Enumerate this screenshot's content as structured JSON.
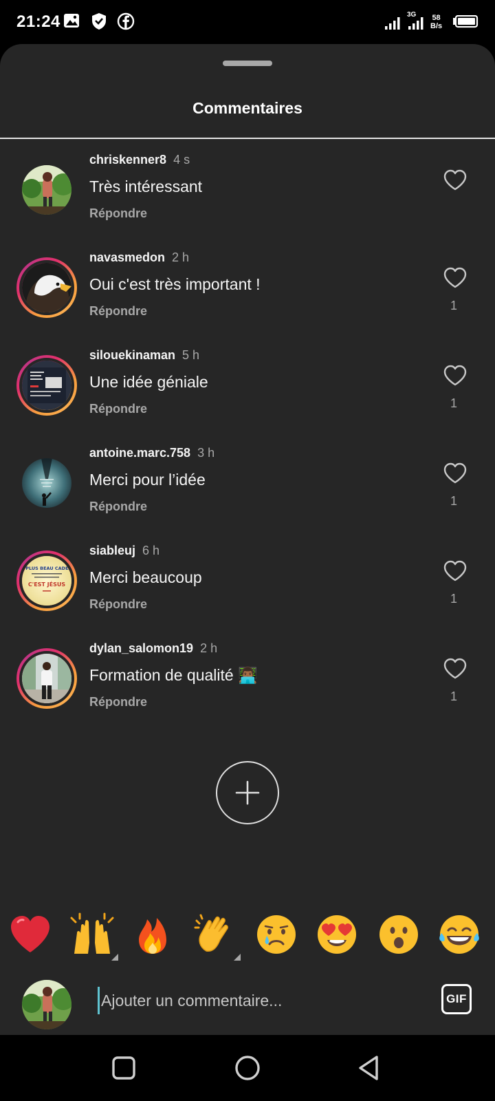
{
  "status_bar": {
    "time": "21:24",
    "network": "3G",
    "speed_value": "58",
    "speed_unit": "B/s",
    "left_icons": [
      "image-icon",
      "shield-icon",
      "facebook-icon"
    ],
    "right_icons": [
      "signal-icon",
      "signal-icon",
      "battery-icon"
    ]
  },
  "sheet": {
    "title": "Commentaires"
  },
  "comments": [
    {
      "username": "chriskenner8",
      "time": "4 s",
      "text": "Très intéressant",
      "reply": "Répondre",
      "likes": "",
      "story_ring": false
    },
    {
      "username": "navasmedon",
      "time": "2 h",
      "text": "Oui c'est très important !",
      "reply": "Répondre",
      "likes": "1",
      "story_ring": true
    },
    {
      "username": "silouekinaman",
      "time": "5 h",
      "text": "Une idée géniale",
      "reply": "Répondre",
      "likes": "1",
      "story_ring": true
    },
    {
      "username": "antoine.marc.758",
      "time": "3 h",
      "text": "Merci pour l’idée",
      "reply": "Répondre",
      "likes": "1",
      "story_ring": false
    },
    {
      "username": "siableuj",
      "time": "6 h",
      "text": "Merci beaucoup",
      "reply": "Répondre",
      "likes": "1",
      "story_ring": true,
      "avatar_text": [
        "LE PLUS BEAU CADEAU",
        "C'EST JÉSUS"
      ]
    },
    {
      "username": "dylan_salomon19",
      "time": "2 h",
      "text": "Formation de qualité 👨🏾‍💻",
      "reply": "Répondre",
      "likes": "1",
      "story_ring": true
    }
  ],
  "add_button": {
    "icon": "plus-icon"
  },
  "emoji_bar": [
    "❤️",
    "🙌",
    "🔥",
    "👏",
    "😢",
    "😍",
    "😮",
    "😂"
  ],
  "composer": {
    "placeholder": "Ajouter un commentaire...",
    "gif_label": "GIF"
  },
  "nav_bar": [
    "recents-icon",
    "home-icon",
    "back-icon"
  ],
  "colors": {
    "sheet_bg": "#262626",
    "text_primary": "#f5f5f5",
    "text_secondary": "#a8a8a8",
    "ring_gradient": [
      "#f9a03f",
      "#e1306c",
      "#c13584"
    ]
  }
}
